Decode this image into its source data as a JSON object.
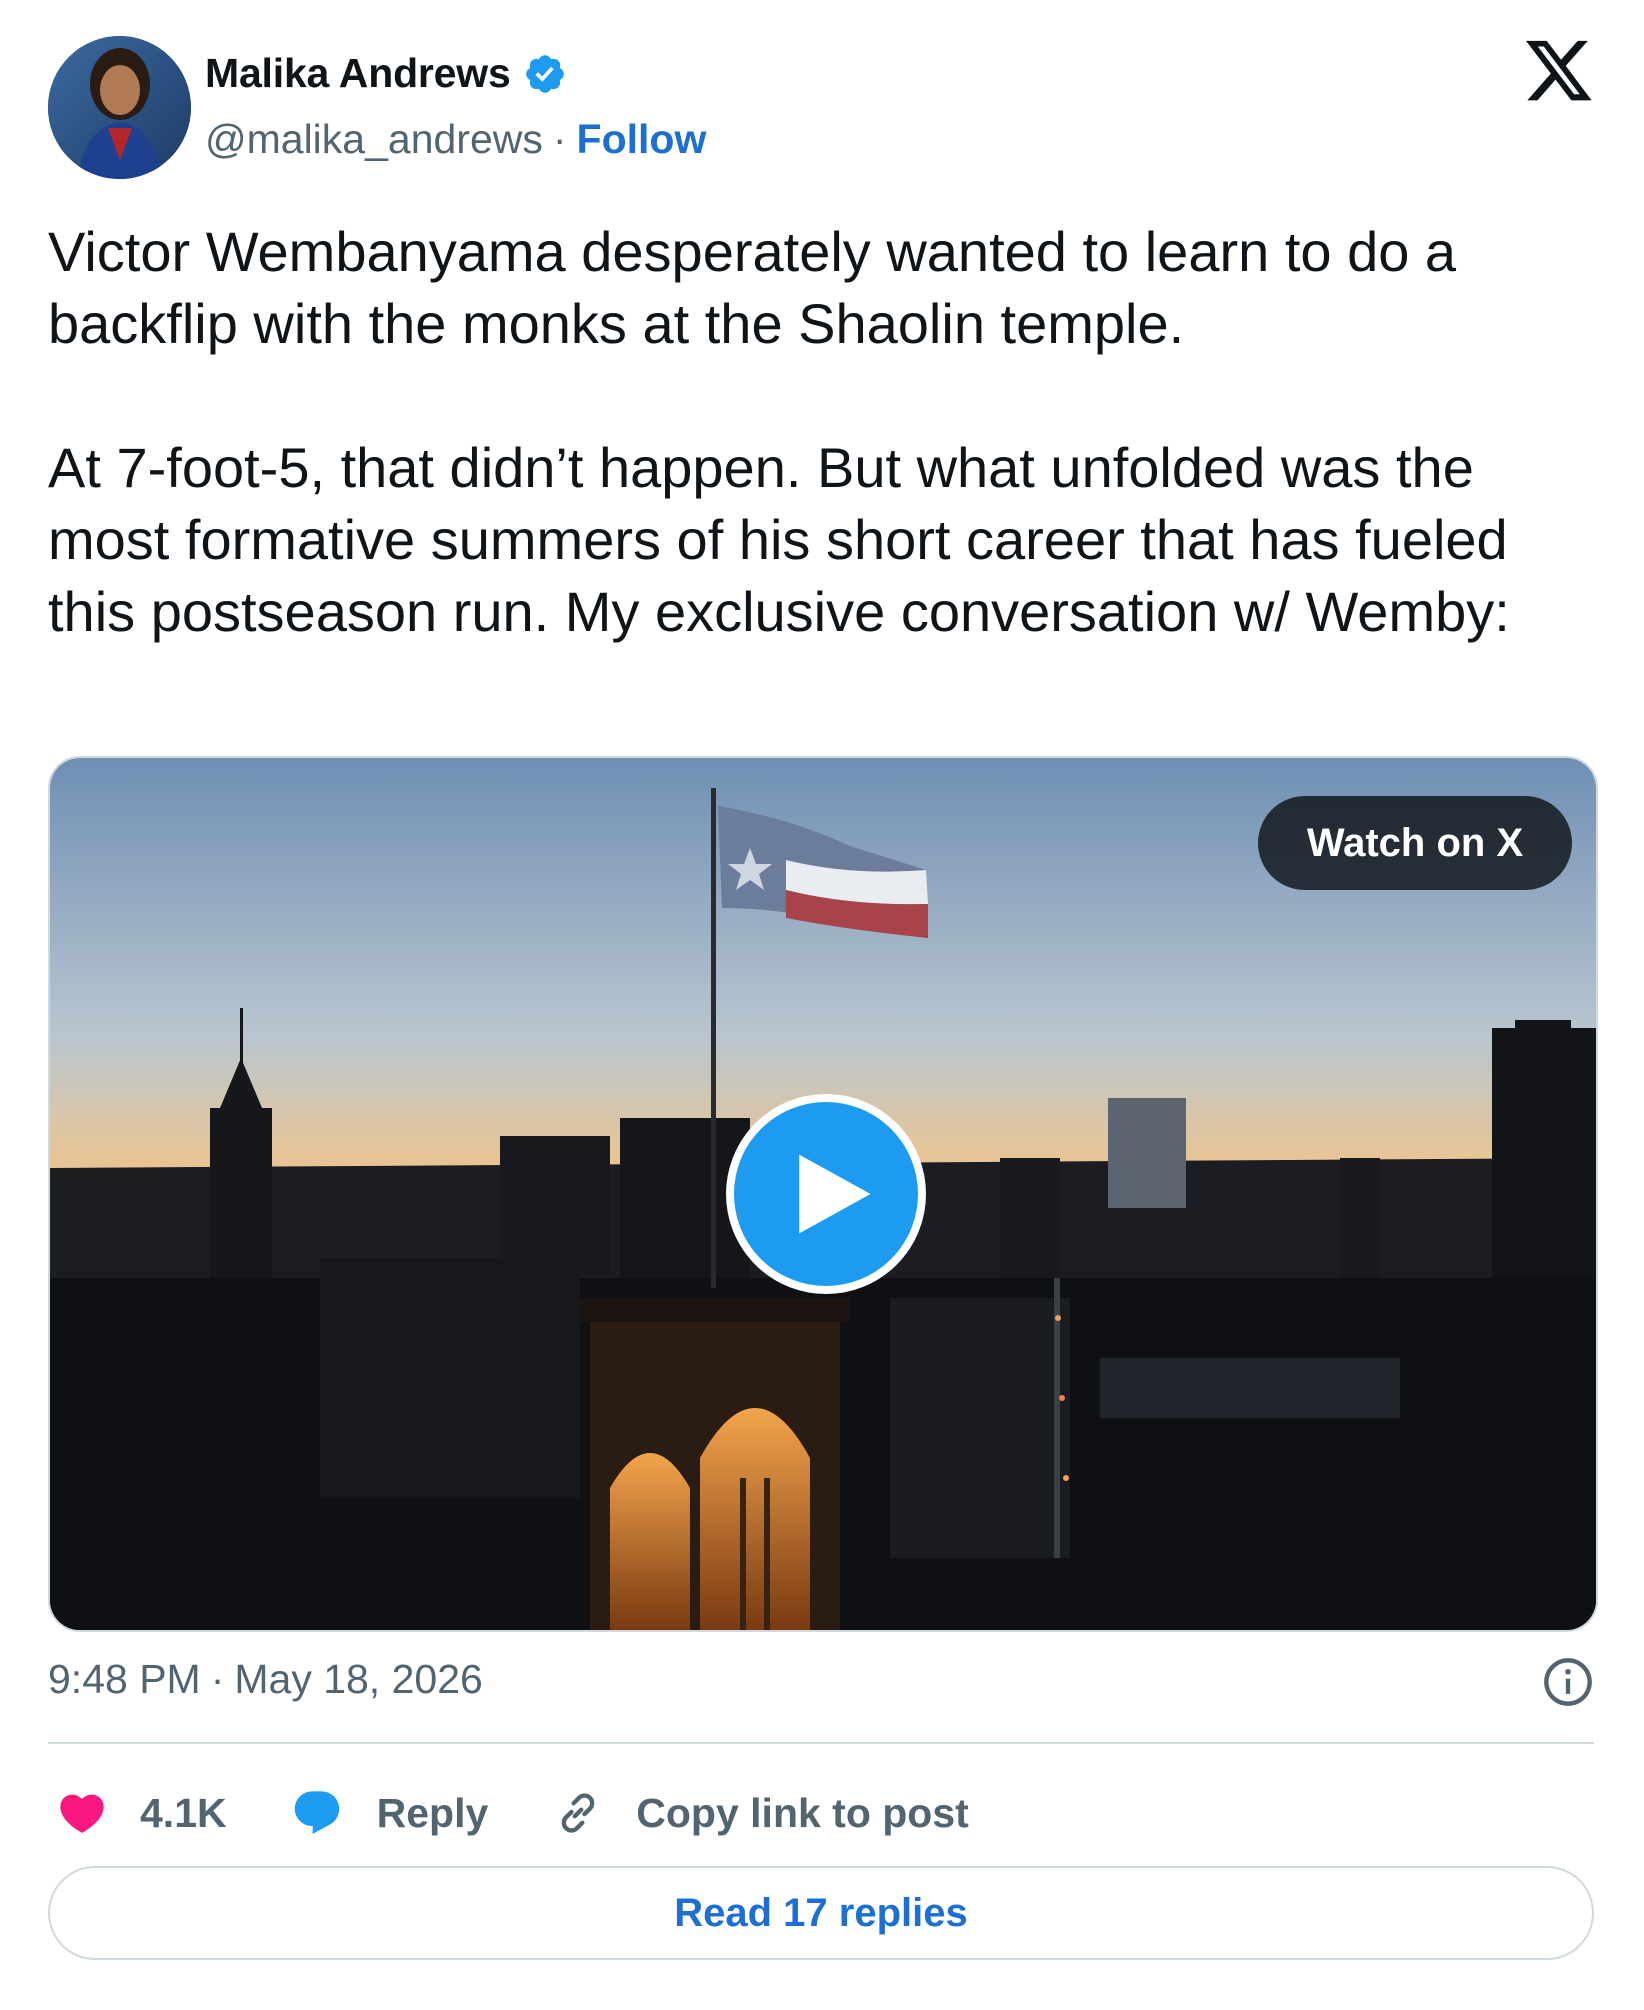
{
  "author": {
    "display_name": "Malika Andrews",
    "handle": "@malika_andrews",
    "separator": "·",
    "follow_label": "Follow",
    "verified": true
  },
  "tweet": {
    "paragraph_1": "Victor Wembanyama desperately wanted to learn to do a backflip with the monks at the Shaolin temple.",
    "paragraph_2": "At 7-foot-5, that didn’t happen. But what unfolded was the most formative summers of his short career that has fueled this postseason run. My exclusive conversation w/ Wemby:"
  },
  "media": {
    "watch_label": "Watch on X",
    "play_icon": "play-icon"
  },
  "meta": {
    "time": "9:48 PM",
    "separator": "·",
    "date": "May 18, 2026"
  },
  "actions": {
    "likes_count": "4.1K",
    "reply_label": "Reply",
    "copy_link_label": "Copy link to post"
  },
  "read_replies_label": "Read 17 replies",
  "colors": {
    "accent": "#1d9bf0",
    "link": "#1d6fd4",
    "like": "#f91880",
    "secondary_text": "#536471"
  }
}
